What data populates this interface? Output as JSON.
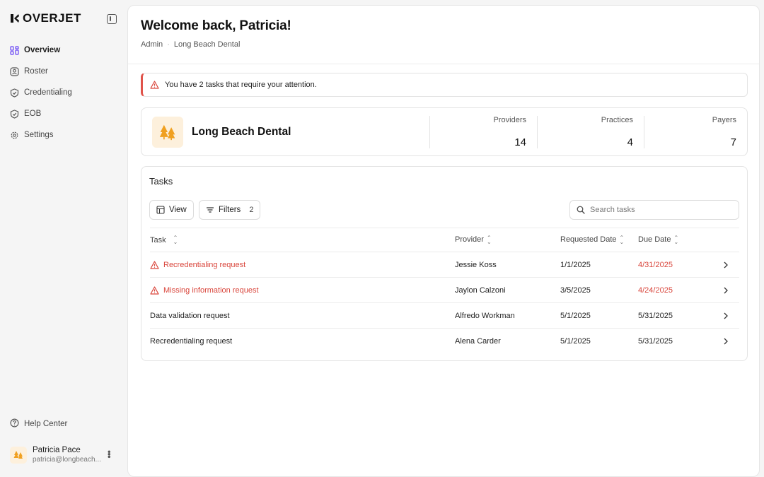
{
  "brand": {
    "name": "OVERJET"
  },
  "nav": {
    "items": [
      {
        "label": "Overview",
        "icon": "overview-icon",
        "active": true
      },
      {
        "label": "Roster",
        "icon": "roster-icon"
      },
      {
        "label": "Credentialing",
        "icon": "shield-check-icon"
      },
      {
        "label": "EOB",
        "icon": "shield-check-icon"
      },
      {
        "label": "Settings",
        "icon": "gear-icon"
      }
    ],
    "help": "Help Center"
  },
  "user": {
    "name": "Patricia Pace",
    "email": "patricia@longbeach..."
  },
  "header": {
    "title": "Welcome back, Patricia!",
    "breadcrumb": [
      "Admin",
      "Long Beach Dental"
    ]
  },
  "alert": {
    "text": "You have 2 tasks that require your attention."
  },
  "org": {
    "name": "Long Beach Dental",
    "stats": [
      {
        "label": "Providers",
        "value": "14"
      },
      {
        "label": "Practices",
        "value": "4"
      },
      {
        "label": "Payers",
        "value": "7"
      }
    ]
  },
  "tasks": {
    "title": "Tasks",
    "view_label": "View",
    "filters_label": "Filters",
    "filters_count": "2",
    "search_placeholder": "Search tasks",
    "columns": [
      "Task",
      "Provider",
      "Requested Date",
      "Due Date"
    ],
    "rows": [
      {
        "task": "Recredentialing request",
        "provider": "Jessie Koss",
        "requested": "1/1/2025",
        "due": "4/31/2025",
        "alert": true
      },
      {
        "task": "Missing information request",
        "provider": "Jaylon Calzoni",
        "requested": "3/5/2025",
        "due": "4/24/2025",
        "alert": true
      },
      {
        "task": "Data validation request",
        "provider": "Alfredo Workman",
        "requested": "5/1/2025",
        "due": "5/31/2025",
        "alert": false
      },
      {
        "task": "Recredentialing request",
        "provider": "Alena Carder",
        "requested": "5/1/2025",
        "due": "5/31/2025",
        "alert": false
      }
    ]
  },
  "colors": {
    "accent": "#7b5cf5",
    "danger": "#d9453b",
    "logo_bg": "#fdf0dc",
    "logo_fg": "#f0a020"
  }
}
